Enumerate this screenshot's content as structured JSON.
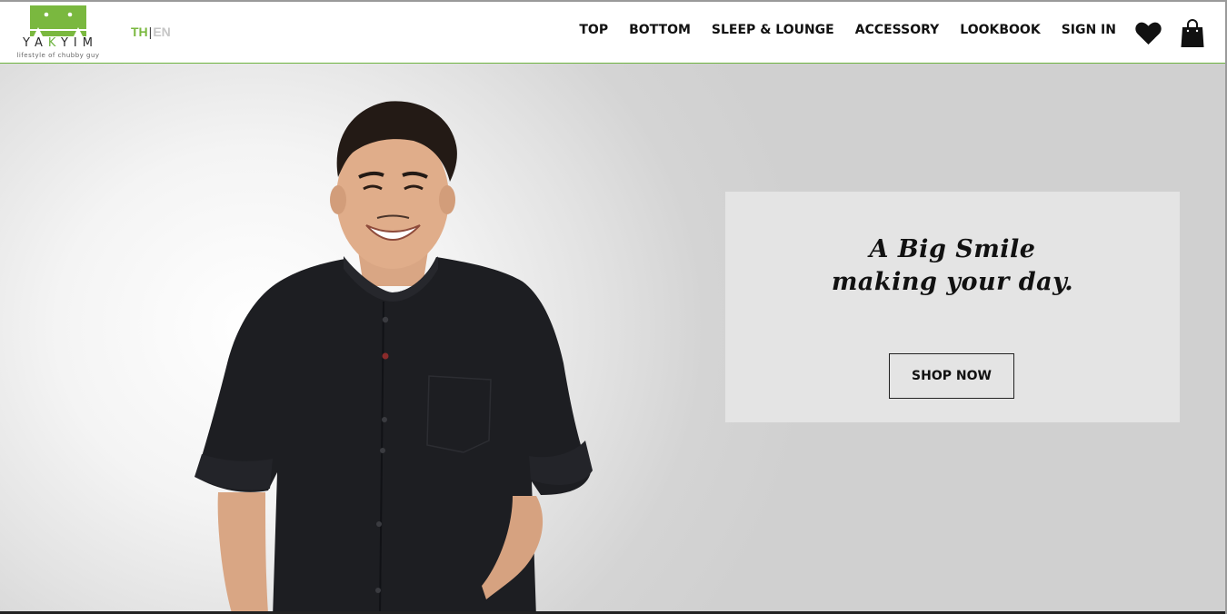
{
  "brand": {
    "name_before": "YA",
    "name_accent": "K",
    "name_after": "YIM",
    "tagline": "lifestyle of chubby guy",
    "accent_color": "#6db33f"
  },
  "language": {
    "active": "TH",
    "separator": "|",
    "inactive": "EN"
  },
  "nav": {
    "items": [
      "TOP",
      "BOTTOM",
      "SLEEP & LOUNGE",
      "ACCESSORY",
      "LOOKBOOK",
      "SIGN IN"
    ]
  },
  "icons": {
    "wishlist": "heart-icon",
    "cart": "shopping-bag-icon"
  },
  "hero": {
    "headline_line1": "A Big Smile",
    "headline_line2": "making your day.",
    "cta_label": "SHOP NOW",
    "background_color": "#d0d0d0",
    "card_color": "#e4e4e4"
  }
}
